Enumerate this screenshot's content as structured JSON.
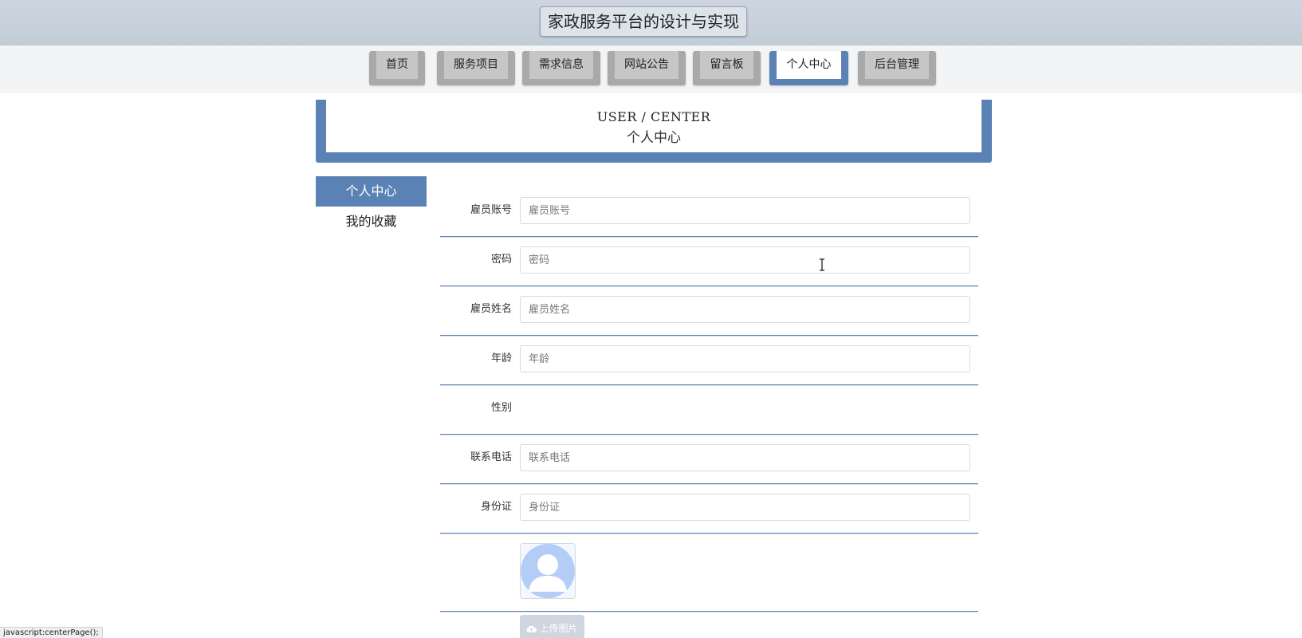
{
  "header": {
    "site_title": "家政服务平台的设计与实现"
  },
  "nav": {
    "items": [
      {
        "label": "首页",
        "active": false
      },
      {
        "label": "服务项目",
        "active": false
      },
      {
        "label": "需求信息",
        "active": false
      },
      {
        "label": "网站公告",
        "active": false
      },
      {
        "label": "留言板",
        "active": false
      },
      {
        "label": "个人中心",
        "active": true
      },
      {
        "label": "后台管理",
        "active": false
      }
    ]
  },
  "banner": {
    "title_en": "USER / CENTER",
    "title_cn": "个人中心"
  },
  "side_menu": {
    "items": [
      {
        "label": "个人中心",
        "active": true
      },
      {
        "label": "我的收藏",
        "active": false
      }
    ]
  },
  "form": {
    "account": {
      "label": "雇员账号",
      "placeholder": "雇员账号",
      "value": ""
    },
    "password": {
      "label": "密码",
      "placeholder": "密码",
      "value": ""
    },
    "name": {
      "label": "雇员姓名",
      "placeholder": "雇员姓名",
      "value": ""
    },
    "age": {
      "label": "年龄",
      "placeholder": "年龄",
      "value": ""
    },
    "gender": {
      "label": "性别"
    },
    "phone": {
      "label": "联系电话",
      "placeholder": "联系电话",
      "value": ""
    },
    "id_card": {
      "label": "身份证",
      "placeholder": "身份证",
      "value": ""
    },
    "avatar": {
      "icon": "user-avatar-icon"
    },
    "upload_label": "上传图片"
  },
  "status_bar": {
    "text": "javascript:centerPage();"
  },
  "colors": {
    "accent": "#5b82b4",
    "nav_inactive": "#a9a9a9",
    "avatar_fill": "#b3cdf6"
  }
}
